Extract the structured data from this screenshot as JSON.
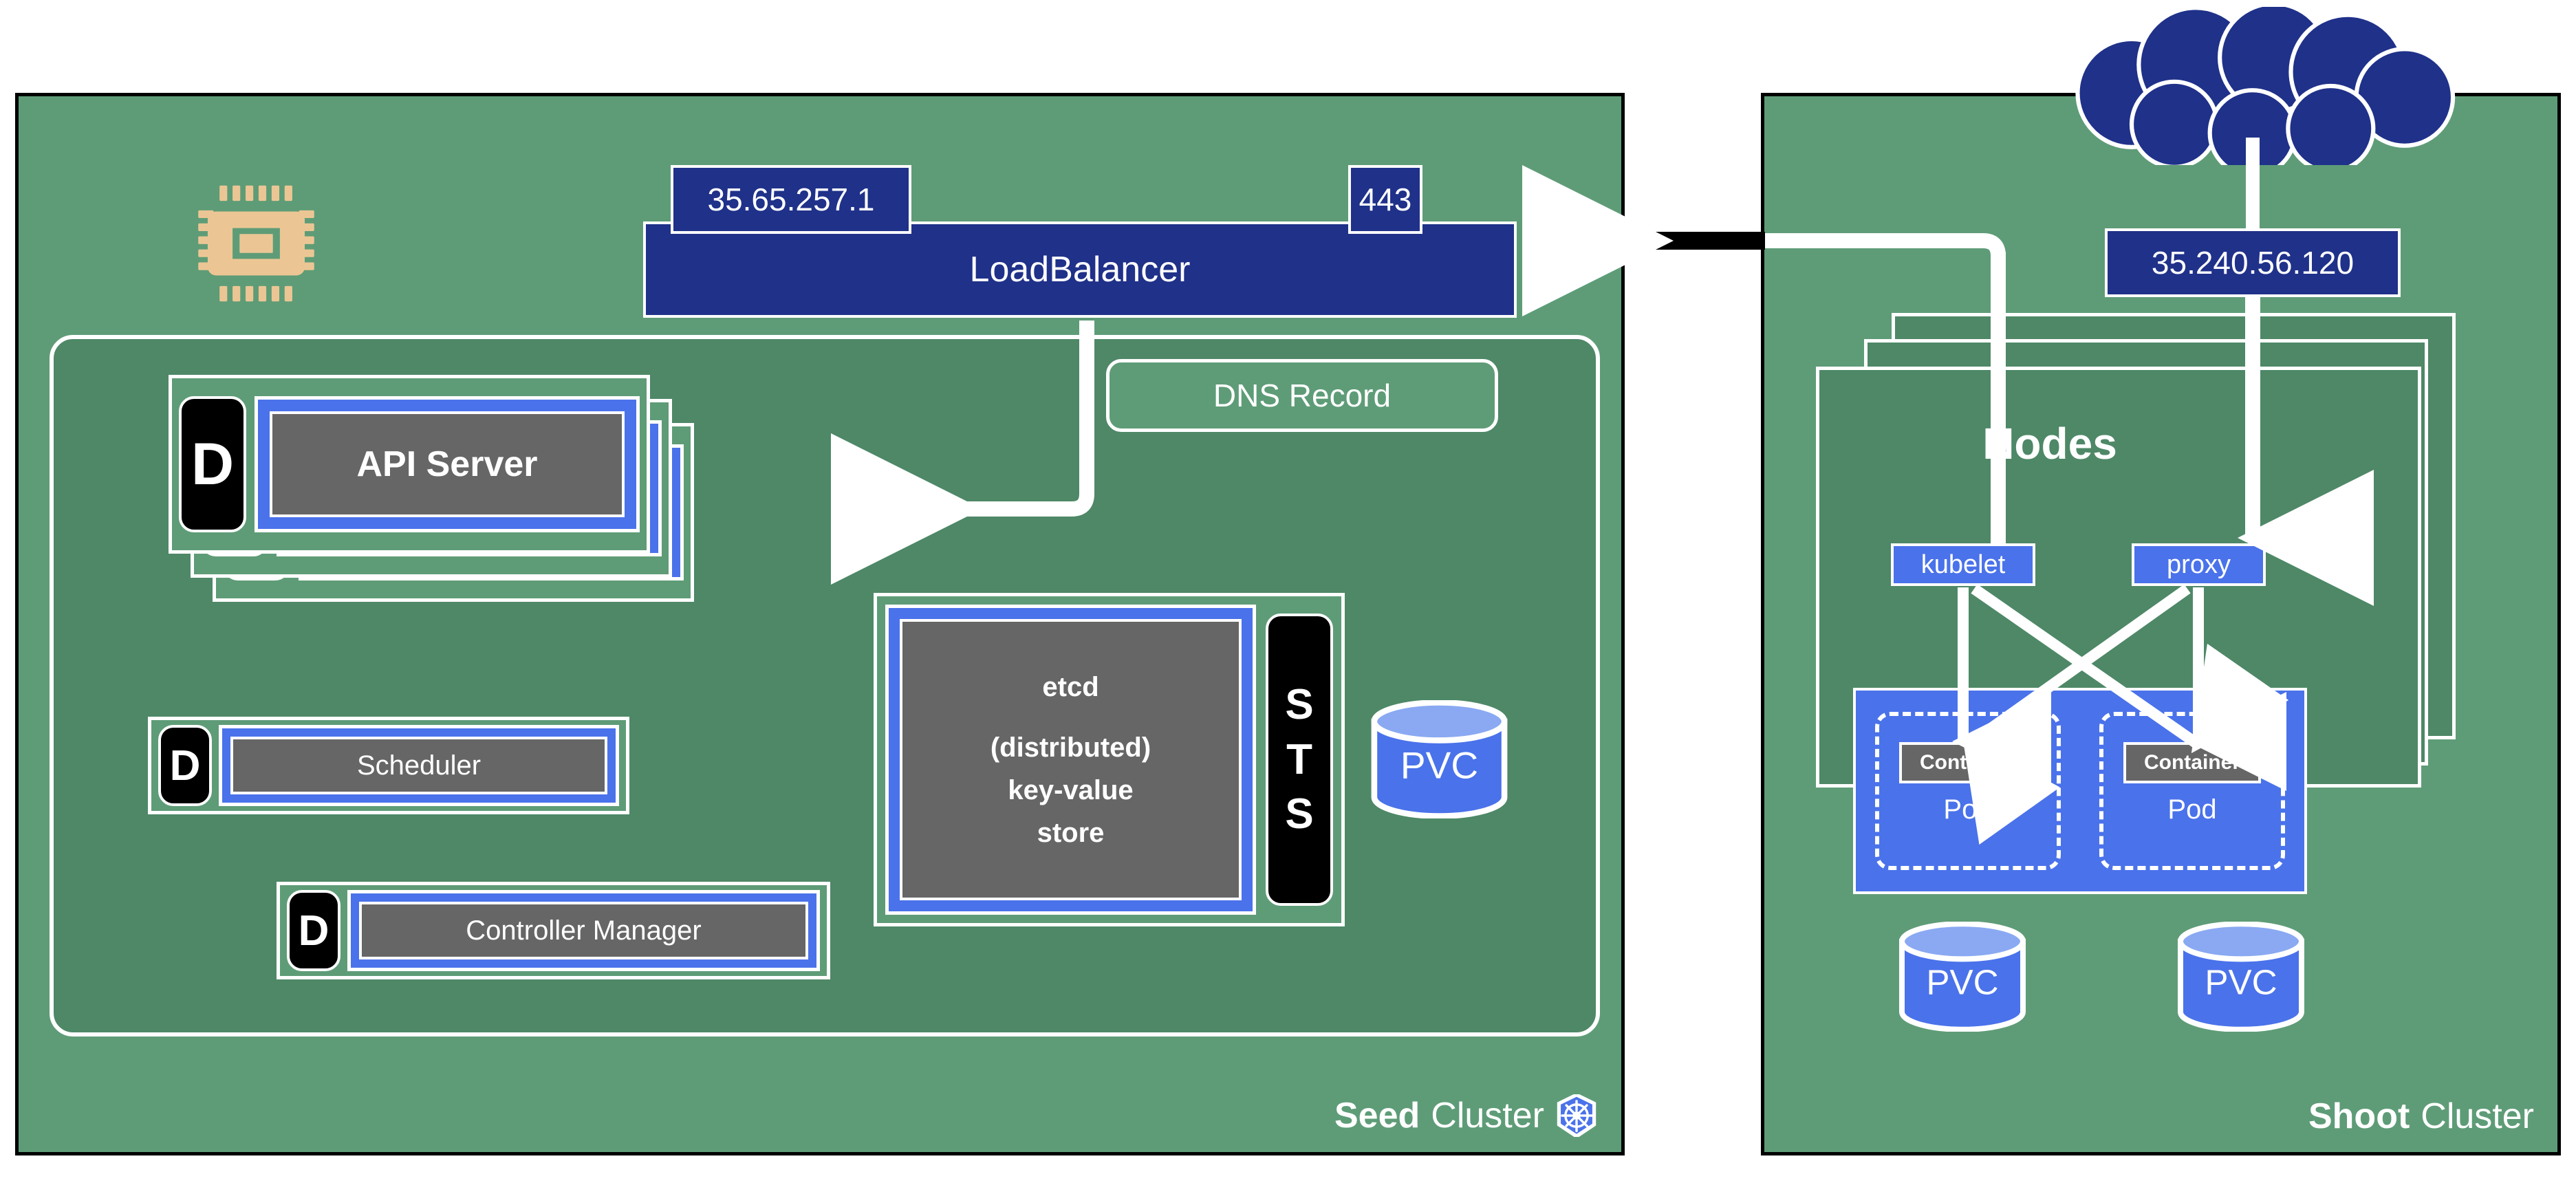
{
  "diagram": {
    "seed_cluster": {
      "label_strong": "Seed",
      "label_rest": "Cluster",
      "logo": "kubernetes-logo",
      "cpu_icon": "cpu-chip-icon",
      "loadbalancer": {
        "title": "LoadBalancer",
        "ip": "35.65.257.1",
        "port": "443"
      },
      "dns_record": "DNS Record",
      "api_server": {
        "badge": "D",
        "title": "API Server",
        "replicas": 3
      },
      "scheduler": {
        "badge": "D",
        "title": "Scheduler"
      },
      "controller_manager": {
        "badge": "D",
        "title": "Controller Manager"
      },
      "etcd": {
        "badge": "STS",
        "badge_letters": [
          "S",
          "T",
          "S"
        ],
        "line1": "etcd",
        "line2": "(distributed)",
        "line3": "key-value",
        "line4": "store"
      },
      "pvc": "PVC"
    },
    "shoot_cluster": {
      "label_strong": "Shoot",
      "label_rest": "Cluster",
      "cloud_icon": "cloud-icon",
      "ip": "35.240.56.120",
      "nodes_title": "Nodes",
      "node_count": 3,
      "kubelet": "kubelet",
      "proxy": "proxy",
      "pods": [
        {
          "container": "Container",
          "label": "Pod"
        },
        {
          "container": "Container",
          "label": "Pod"
        }
      ],
      "pvcs": [
        "PVC",
        "PVC"
      ]
    },
    "colors": {
      "cluster_green": "#5e9c77",
      "panel_green": "#4e8867",
      "navy": "#1f3189",
      "blue": "#4a72ea",
      "gray": "#666666",
      "white": "#ffffff",
      "black": "#000000",
      "chip_tan": "#ebc694",
      "pvc_top": "#8aa9f2"
    }
  }
}
